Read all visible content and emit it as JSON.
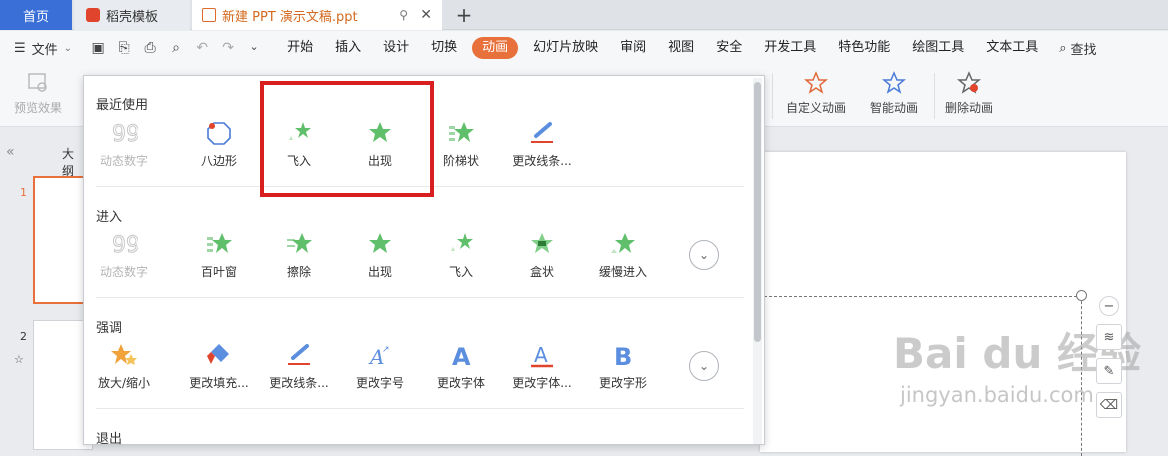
{
  "tabs": {
    "home": "首页",
    "template": "稻壳模板",
    "document": "新建 PPT 演示文稿.ppt",
    "add": "+"
  },
  "menubar": {
    "file": "文件",
    "items": [
      "开始",
      "插入",
      "设计",
      "切换",
      "动画",
      "幻灯片放映",
      "审阅",
      "视图",
      "安全",
      "开发工具",
      "特色功能",
      "绘图工具",
      "文本工具"
    ],
    "active": "动画",
    "search": "查找"
  },
  "ribbon": {
    "preview": "预览效果",
    "custom_anim": "自定义动画",
    "smart_anim": "智能动画",
    "delete_anim": "删除动画"
  },
  "left_pane": {
    "outline": "大纲",
    "slide1": "1",
    "slide2": "2"
  },
  "panel": {
    "recent": {
      "title": "最近使用",
      "items": [
        "动态数字",
        "八边形",
        "飞入",
        "出现",
        "阶梯状",
        "更改线条..."
      ]
    },
    "entrance": {
      "title": "进入",
      "items": [
        "动态数字",
        "百叶窗",
        "擦除",
        "出现",
        "飞入",
        "盒状",
        "缓慢进入"
      ]
    },
    "emphasis": {
      "title": "强调",
      "items": [
        "放大/缩小",
        "更改填充...",
        "更改线条...",
        "更改字号",
        "更改字体",
        "更改字体...",
        "更改字形"
      ]
    },
    "exit": {
      "title": "退出"
    }
  },
  "colors": {
    "accent": "#e8703a",
    "home_tab": "#3a6fd8",
    "highlight_box": "#d81e1e",
    "star_green": "#5fbf6a",
    "emphasis_blue": "#5b8ede"
  },
  "watermark": {
    "main": "Bai du 经验",
    "sub": "jingyan.baidu.com"
  }
}
